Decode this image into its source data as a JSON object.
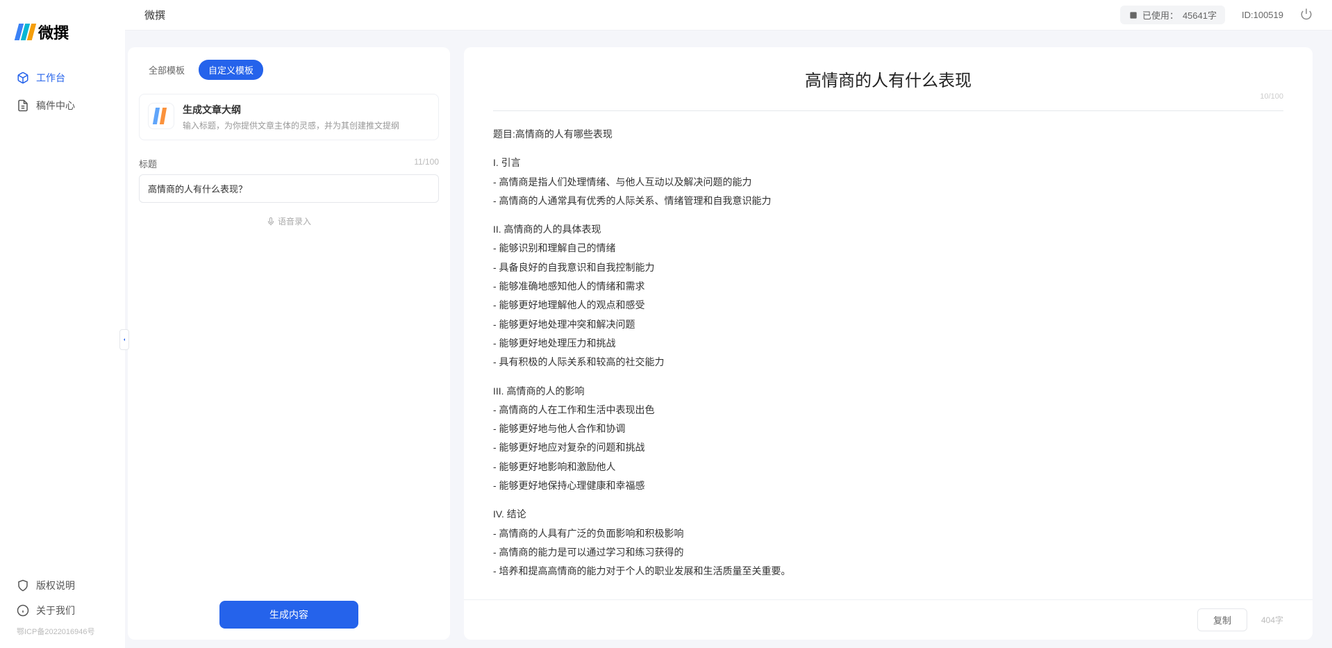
{
  "app_name": "微撰",
  "topbar": {
    "title": "微撰",
    "usage_label": "已使用：",
    "usage_value": "45641字",
    "user_id_label": "ID:",
    "user_id": "100519"
  },
  "sidebar": {
    "nav": [
      {
        "label": "工作台",
        "active": true
      },
      {
        "label": "稿件中心",
        "active": false
      }
    ],
    "footer": [
      {
        "label": "版权说明"
      },
      {
        "label": "关于我们"
      }
    ],
    "icp": "鄂ICP备2022016946号"
  },
  "left_panel": {
    "tabs": [
      {
        "label": "全部模板",
        "active": false
      },
      {
        "label": "自定义模板",
        "active": true
      }
    ],
    "template": {
      "title": "生成文章大纲",
      "desc": "输入标题，为你提供文章主体的灵感，并为其创建推文提纲"
    },
    "field": {
      "label": "标题",
      "counter": "11/100",
      "value": "高情商的人有什么表现？"
    },
    "voice_label": "语音录入",
    "generate_label": "生成内容"
  },
  "output": {
    "title": "高情商的人有什么表现",
    "title_counter": "10/100",
    "sections": [
      [
        "题目:高情商的人有哪些表现"
      ],
      [
        "I. 引言",
        "- 高情商是指人们处理情绪、与他人互动以及解决问题的能力",
        "- 高情商的人通常具有优秀的人际关系、情绪管理和自我意识能力"
      ],
      [
        "II. 高情商的人的具体表现",
        "- 能够识别和理解自己的情绪",
        "- 具备良好的自我意识和自我控制能力",
        "- 能够准确地感知他人的情绪和需求",
        "- 能够更好地理解他人的观点和感受",
        "- 能够更好地处理冲突和解决问题",
        "- 能够更好地处理压力和挑战",
        "- 具有积极的人际关系和较高的社交能力"
      ],
      [
        "III. 高情商的人的影响",
        "- 高情商的人在工作和生活中表现出色",
        "- 能够更好地与他人合作和协调",
        "- 能够更好地应对复杂的问题和挑战",
        "- 能够更好地影响和激励他人",
        "- 能够更好地保持心理健康和幸福感"
      ],
      [
        "IV. 结论",
        "- 高情商的人具有广泛的负面影响和积极影响",
        "- 高情商的能力是可以通过学习和练习获得的",
        "- 培养和提高高情商的能力对于个人的职业发展和生活质量至关重要。"
      ]
    ],
    "copy_label": "复制",
    "word_count": "404字"
  }
}
